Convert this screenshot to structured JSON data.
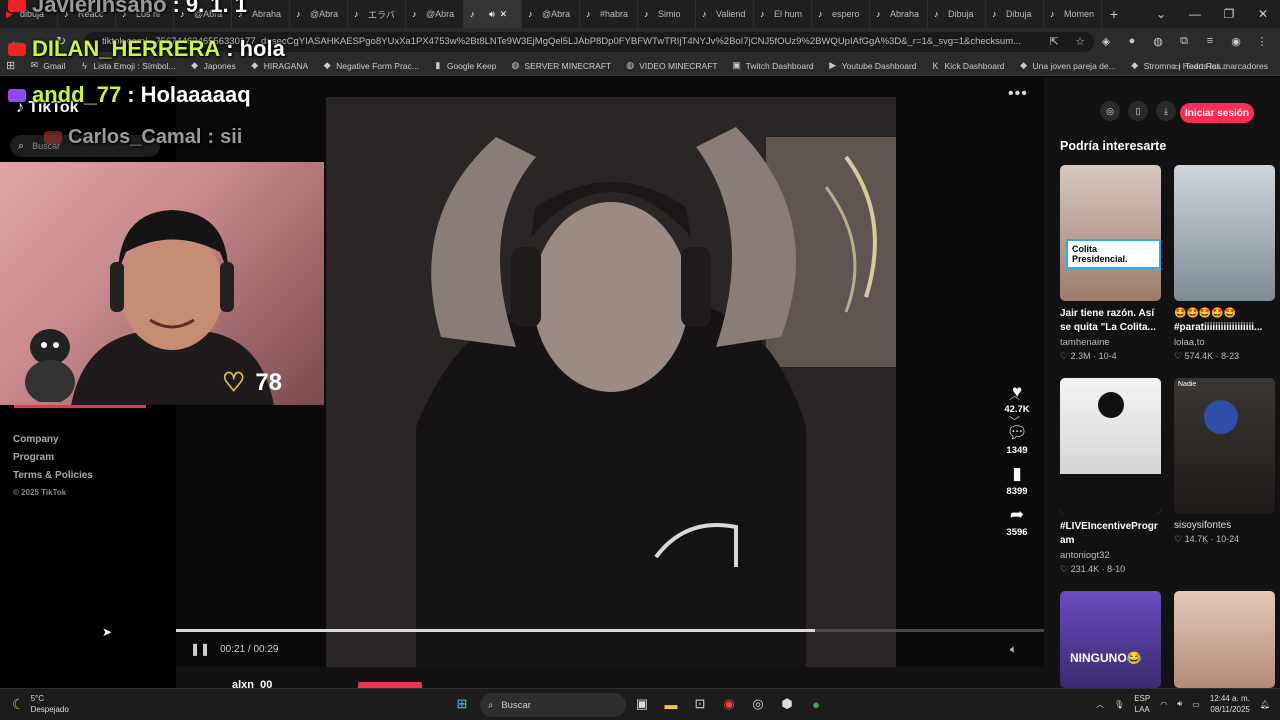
{
  "browser": {
    "tabs": [
      {
        "label": "dibuja",
        "icon": "youtube-icon"
      },
      {
        "label": "Reacc",
        "icon": "tiktok-icon"
      },
      {
        "label": "Los ni",
        "icon": "tiktok-icon"
      },
      {
        "label": "@Abra",
        "icon": "tiktok-icon"
      },
      {
        "label": "Abraha",
        "icon": "tiktok-icon"
      },
      {
        "label": "@Abra",
        "icon": "tiktok-icon"
      },
      {
        "label": "エラバ",
        "icon": "tiktok-icon"
      },
      {
        "label": "@Abra",
        "icon": "tiktok-icon"
      },
      {
        "label": "",
        "icon": "tiktok-icon",
        "active": true
      },
      {
        "label": "@Abra",
        "icon": "tiktok-icon"
      },
      {
        "label": "#habra",
        "icon": "tiktok-icon"
      },
      {
        "label": "Simio",
        "icon": "tiktok-icon"
      },
      {
        "label": "Valiend",
        "icon": "tiktok-icon"
      },
      {
        "label": "El hum",
        "icon": "tiktok-icon"
      },
      {
        "label": "espero",
        "icon": "tiktok-icon"
      },
      {
        "label": "Abraha",
        "icon": "tiktok-icon"
      },
      {
        "label": "Dibuja",
        "icon": "tiktok-icon"
      },
      {
        "label": "Dibuja",
        "icon": "tiktok-icon"
      },
      {
        "label": "Momen",
        "icon": "tiktok-icon"
      }
    ],
    "new_tab": "+",
    "url": "tiktok.com/...7567446246556330177_d=secCgYIASAHKAESPgo8YUxXa1PX4753w%2Bt8LNTe9W3EjMgQel5LJAbP8Dp0FYBFWTwTRIjT4NYJv%2BoI7jCNJ5fOUz9%2BWQUpIAfGgA%3D&_r=1&_svg=1&checksum...",
    "bookmarks": [
      {
        "label": "Gmail",
        "icon": "gmail-icon"
      },
      {
        "label": "Lista Emoji : Símbol...",
        "icon": "emoji-icon"
      },
      {
        "label": "Japones",
        "icon": "bookmark-icon"
      },
      {
        "label": "HIRAGANA",
        "icon": "bookmark-icon"
      },
      {
        "label": "Negative Form Prac...",
        "icon": "bookmark-icon"
      },
      {
        "label": "Google Keep",
        "icon": "keep-icon"
      },
      {
        "label": "SERVER MINECRAFT",
        "icon": "globe-icon"
      },
      {
        "label": "VIDEO MINECRAFT",
        "icon": "globe-icon"
      },
      {
        "label": "Twitch Dashboard",
        "icon": "twitch-icon"
      },
      {
        "label": "Youtube Dashboard",
        "icon": "youtube-icon"
      },
      {
        "label": "Kick Dashboard",
        "icon": "kick-icon"
      },
      {
        "label": "Una joven pareja de...",
        "icon": "bookmark-icon"
      },
      {
        "label": "Stromno | Heart Rat...",
        "icon": "bookmark-icon"
      }
    ],
    "all_bookmarks": "Todos los marcadores"
  },
  "tiktok": {
    "logo": "TikTok",
    "search_placeholder": "Buscar",
    "footer_links": [
      "Company",
      "Program",
      "Terms & Policies"
    ],
    "copyright": "© 2025 TikTok",
    "player": {
      "time": "00:21 / 00:29",
      "progress": 0.736
    },
    "actions": {
      "likes": "42.7K",
      "comments": "1349",
      "saves": "8399",
      "shares": "3596"
    },
    "caption_user": "alxn_00",
    "login_button": "Iniciar sesión",
    "suggested_title": "Podría interesarte",
    "suggestions": [
      {
        "desc": "Jair tiene razón. Así se quita \"La Colita...",
        "author": "tamhenaine",
        "likes": "2.3M",
        "date": "10-4",
        "overlay": "Colita Presidencial."
      },
      {
        "desc": "🤩🤩🤩🤩🤩 #paratiiiiiiiiiiiiiiiiii...",
        "author": "lolaa.to",
        "likes": "574.4K",
        "date": "8-23",
        "overlay": ""
      },
      {
        "desc": "#LIVEIncentiveProgr am #LIVECanBeEas...",
        "author": "antoniogt32",
        "likes": "231.4K",
        "date": "8-10",
        "overlay": ""
      },
      {
        "desc": "",
        "author": "sisoysifontes",
        "likes": "14.7K",
        "date": "10-24",
        "overlay": "Nadie"
      },
      {
        "desc": "",
        "author": "",
        "likes": "",
        "date": "",
        "overlay": "NINGUNO😂"
      },
      {
        "desc": "",
        "author": "",
        "likes": "",
        "date": "",
        "overlay": ""
      }
    ]
  },
  "stream_overlay": {
    "heart_rate": "78",
    "chat": [
      {
        "name": "JavierInsano",
        "message": "9. 1. 1",
        "platform_color": "#e22"
      },
      {
        "name": "DILAN_HERRERA",
        "message": "hola",
        "platform_color": "#e22"
      },
      {
        "name": "andd_77",
        "message": "Holaaaaaq",
        "platform_color": "#9146ff"
      },
      {
        "name": "Carlos_Camal",
        "message": "sii",
        "platform_color": "#e22"
      }
    ]
  },
  "taskbar": {
    "temperature": "5°C",
    "weather": "Despejado",
    "search": "Buscar",
    "lang": "ESP",
    "lang2": "LAA",
    "time": "12:44 a. m.",
    "date": "08/11/2025"
  }
}
